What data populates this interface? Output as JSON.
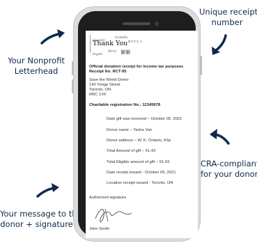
{
  "callouts": {
    "letterhead": [
      "Your Nonprofit",
      "Letterhead"
    ],
    "receipt_number": [
      "Unique receipt",
      "number"
    ],
    "cra": [
      "CRA-compliant",
      "for your donor"
    ],
    "message": [
      "Your message to the",
      "donor + signature"
    ]
  },
  "letterhead": {
    "words": [
      "Cracado",
      "Gratidão",
      "Thank You",
      "Merci",
      "Argato",
      "谢谢",
      "ありがとう"
    ]
  },
  "receipt": {
    "title": "Official donation receipt for income tax purposes",
    "number": "Receipt No. RCT-95",
    "org_lines": [
      "Save the World Demo",
      "140 Yonge Street",
      "Toronto, ON",
      "M5C 1X6"
    ],
    "charity_reg": "Charitable registration No.: 12345678",
    "items": [
      "Date gift was received – October 05, 2021",
      "Donor name – Tasha Van",
      "Donor address – W, K, Ontario, K6p",
      "Total Amount of gift – 51.43",
      "Total Eligible amount of gift – 51.43",
      "Date receipt issued - October 05, 2021",
      "Location receipt issued - Toronto, ON"
    ],
    "auth_sig": "Authorized signature",
    "signer": "John Smith"
  },
  "colors": {
    "text": "#0f2a4a",
    "arrow": "#0f2a4a",
    "phone_frame": "#1e1e1e"
  }
}
